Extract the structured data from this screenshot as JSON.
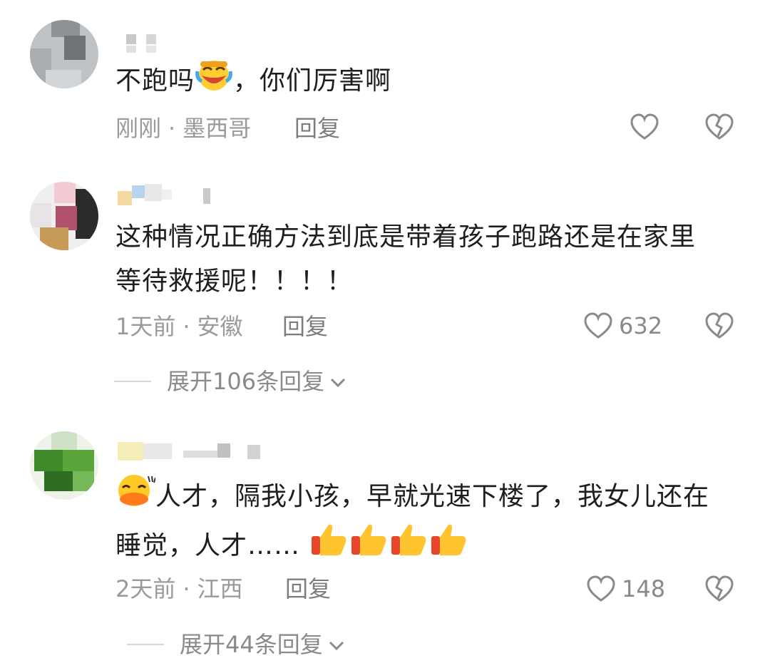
{
  "comments": [
    {
      "text_before": "不跑吗",
      "text_after": "，你们厉害啊",
      "emoji": "crying-laughing-emoji",
      "time": "刚刚",
      "location": "墨西哥",
      "reply_label": "回复",
      "likes": ""
    },
    {
      "line1": "这种情况正确方法到底是带着孩子跑路还是在家里",
      "line2": "等待救援呢！！！！",
      "time": "1天前",
      "location": "安徽",
      "reply_label": "回复",
      "likes": "632",
      "expand_label": "展开106条回复"
    },
    {
      "emoji": "laughing-duck-emoji",
      "line1": "人才，隔我小孩，早就光速下楼了，我女儿还在",
      "line2": "睡觉，人才……",
      "thumbs_emoji": "thumbs-up-emoji",
      "time": "2天前",
      "location": "江西",
      "reply_label": "回复",
      "likes": "148",
      "expand_label": "展开44条回复"
    }
  ],
  "separator": "·",
  "colors": {
    "meta": "#9a9a9a",
    "text": "#1e1e1e",
    "icon": "#8a8a8a"
  }
}
